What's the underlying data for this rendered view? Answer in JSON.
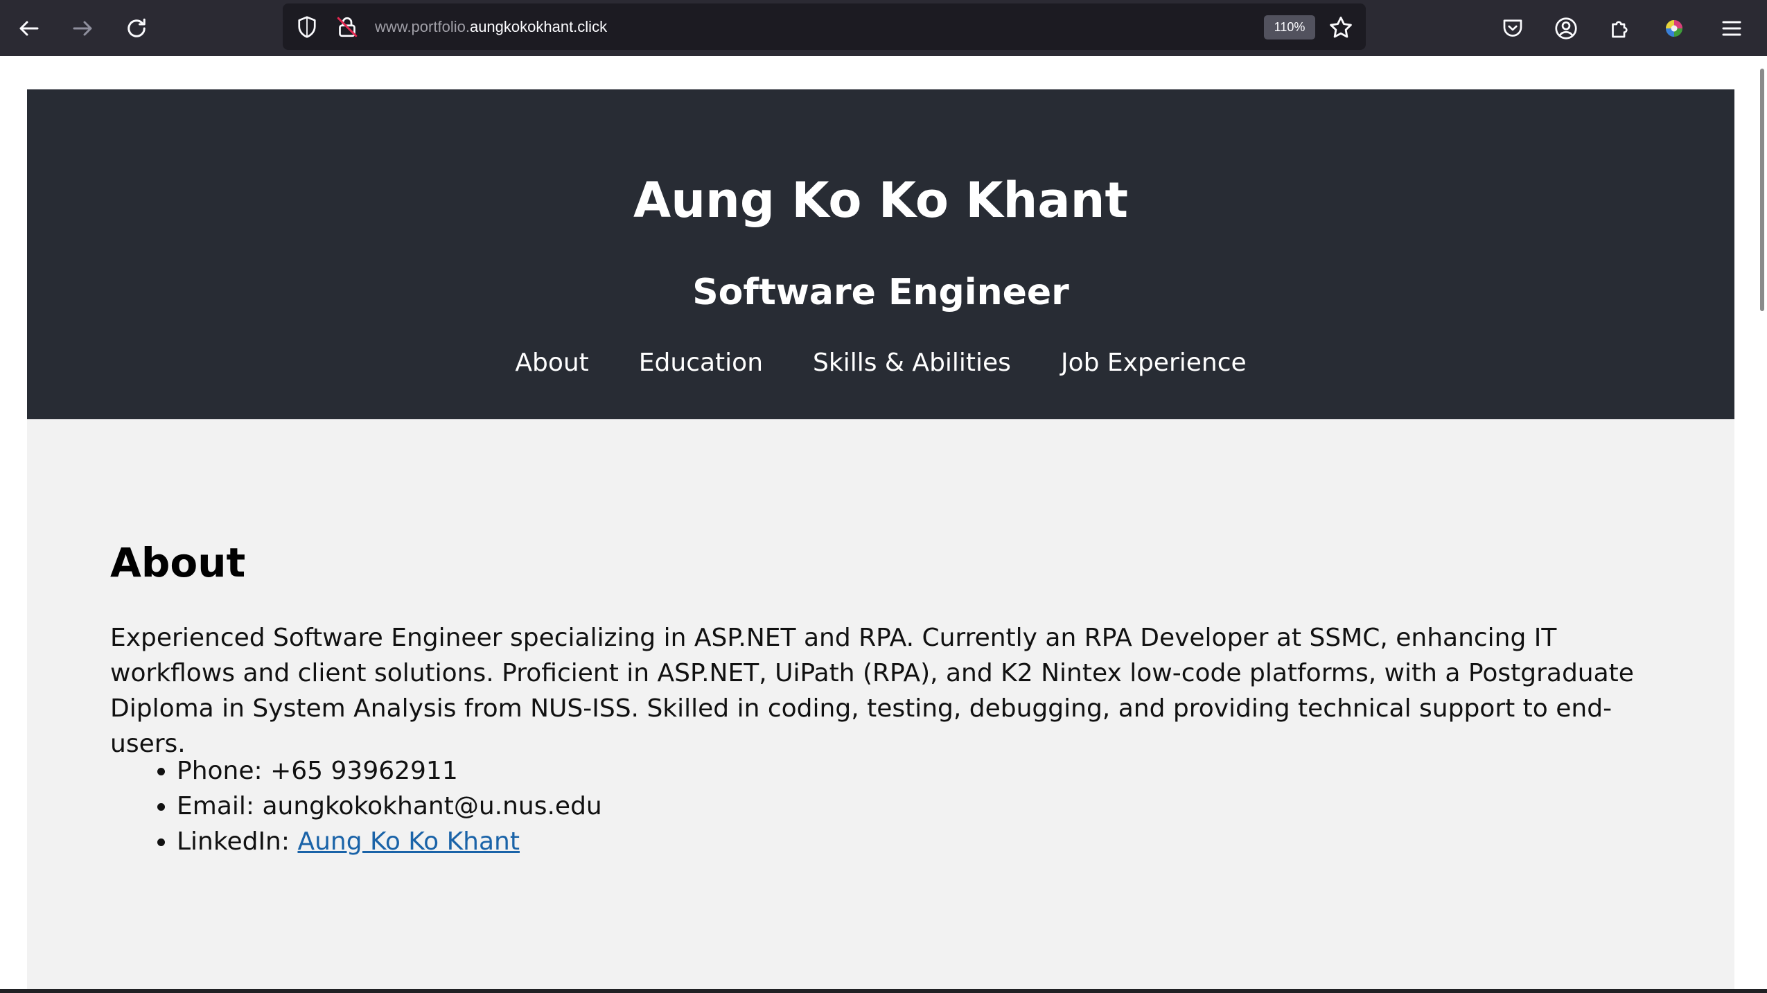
{
  "browser": {
    "url_prefix": "www.portfolio.",
    "url_domain": "aungkokokhant.click",
    "zoom": "110%",
    "icons": {
      "back": "arrow-left-icon",
      "forward": "arrow-right-icon",
      "reload": "reload-icon",
      "tracking": "shield-icon",
      "security": "lock-insecure-icon",
      "bookmark": "star-icon",
      "pocket": "pocket-icon",
      "account": "account-icon",
      "extensions": "puzzle-icon",
      "profile": "colorful-extension-icon",
      "menu": "hamburger-menu-icon"
    }
  },
  "header": {
    "name": "Aung Ko Ko Khant",
    "role": "Software Engineer",
    "nav": [
      {
        "label": "About"
      },
      {
        "label": "Education"
      },
      {
        "label": "Skills & Abilities"
      },
      {
        "label": "Job Experience"
      }
    ]
  },
  "about": {
    "title": "About",
    "description": "Experienced Software Engineer specializing in ASP.NET and RPA. Currently an RPA Developer at SSMC, enhancing IT workflows and client solutions. Proficient in ASP.NET, UiPath (RPA), and K2 Nintex low-code platforms, with a Postgraduate Diploma in System Analysis from NUS-ISS. Skilled in coding, testing, debugging, and providing technical support to end-users.",
    "contacts": {
      "phone": "Phone: +65 93962911",
      "email": "Email: aungkokokhant@u.nus.edu",
      "linkedin_label": "LinkedIn: ",
      "linkedin_link": "Aung Ko Ko Khant"
    }
  },
  "colors": {
    "chrome_bg": "#2b2a33",
    "urlbar_bg": "#1c1b22",
    "header_bg": "#282c34",
    "main_bg": "#f2f2f2",
    "link": "#1a63a8"
  }
}
